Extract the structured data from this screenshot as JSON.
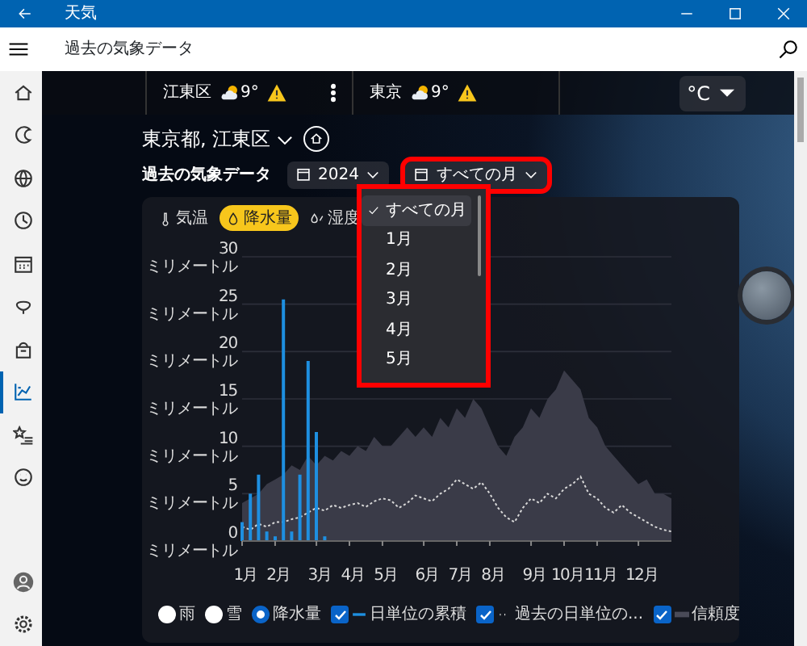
{
  "window": {
    "title": "天気"
  },
  "header": {
    "title": "過去の気象データ"
  },
  "sidebar": {
    "items": [
      {
        "selected": false
      },
      {
        "selected": false
      },
      {
        "selected": false
      },
      {
        "selected": false
      },
      {
        "selected": false
      },
      {
        "selected": false
      },
      {
        "selected": false
      },
      {
        "selected": true
      },
      {
        "selected": false
      },
      {
        "selected": false
      }
    ]
  },
  "locations": [
    {
      "name": "江東区",
      "temp": "9°",
      "alert": true
    },
    {
      "name": "東京",
      "temp": "9°",
      "alert": true
    }
  ],
  "unit": "°C",
  "place": {
    "name": "東京都, 江東区"
  },
  "filters": {
    "title": "過去の気象データ",
    "year": "2024",
    "month": "すべての月",
    "highlighted": true
  },
  "month_menu": {
    "highlighted": true,
    "items": [
      {
        "label": "すべての月",
        "selected": true
      },
      {
        "label": "1月",
        "selected": false
      },
      {
        "label": "2月",
        "selected": false
      },
      {
        "label": "3月",
        "selected": false
      },
      {
        "label": "4月",
        "selected": false
      },
      {
        "label": "5月",
        "selected": false
      }
    ]
  },
  "tabs": [
    {
      "label": "気温",
      "selected": false
    },
    {
      "label": "降水量",
      "selected": true
    },
    {
      "label": "湿度",
      "selected": false
    }
  ],
  "chart": {
    "chart_data": {
      "type": "bar",
      "grid": true,
      "ylim": [
        0,
        30
      ],
      "yticks": [
        {
          "value": 0,
          "label": "0 ミリメートル"
        },
        {
          "value": 5,
          "label": "5 ミリメートル"
        },
        {
          "value": 10,
          "label": "10 ミリメートル"
        },
        {
          "value": 15,
          "label": "15 ミリメートル"
        },
        {
          "value": 20,
          "label": "20 ミリメートル"
        },
        {
          "value": 25,
          "label": "25 ミリメートル"
        },
        {
          "value": 30,
          "label": "30 ミリメートル"
        }
      ],
      "categories": [
        "1月",
        null,
        null,
        null,
        "2月",
        null,
        null,
        null,
        null,
        "3月",
        null,
        null,
        null,
        "4月",
        null,
        null,
        null,
        "5月",
        null,
        null,
        null,
        null,
        "6月",
        null,
        null,
        null,
        "7月",
        null,
        null,
        null,
        "8月",
        null,
        null,
        null,
        null,
        "9月",
        null,
        null,
        null,
        "10月",
        null,
        null,
        null,
        "11月",
        null,
        null,
        null,
        null,
        "12月",
        null,
        null,
        null,
        null
      ],
      "series": [
        {
          "name": "日単位の累積",
          "type": "bar",
          "color": "#1e8fe0",
          "values": [
            2,
            5,
            7,
            1,
            0.5,
            25.5,
            1,
            7,
            19,
            11.5,
            0.5,
            null,
            null,
            null,
            null,
            null,
            null,
            null,
            null,
            null,
            null,
            null,
            null,
            null,
            null,
            null,
            null,
            null,
            null,
            null,
            null,
            null,
            null,
            null,
            null,
            null,
            null,
            null,
            null,
            null,
            null,
            null,
            null,
            null,
            null,
            null,
            null,
            null,
            null,
            null,
            null,
            null,
            null
          ]
        },
        {
          "name": "過去の日単位の...",
          "type": "line",
          "line_style": "dotted",
          "color": "#d8d8d8",
          "values": [
            1.5,
            1.2,
            1.8,
            1.5,
            2,
            2,
            2.3,
            2.5,
            3,
            3.5,
            3.2,
            3.8,
            3.5,
            3.8,
            4,
            3.6,
            4.2,
            4.5,
            4.3,
            3.5,
            4,
            4.8,
            4.5,
            4.2,
            5,
            5.5,
            6.5,
            6,
            5.5,
            6.2,
            5,
            3.5,
            2.5,
            2,
            3.5,
            4.5,
            4,
            5,
            4.5,
            5.5,
            6,
            6.8,
            5,
            4.5,
            3.5,
            3,
            3.8,
            3,
            2.5,
            2,
            1.5,
            1.2,
            1
          ]
        },
        {
          "name": "信頼度",
          "type": "area",
          "color": "#3a3b48",
          "values": [
            4,
            4.5,
            5,
            6,
            6.5,
            7,
            8,
            7.5,
            9,
            8,
            9,
            8.5,
            9.5,
            9,
            10,
            9.5,
            11,
            10,
            10,
            11,
            12,
            11,
            12,
            11,
            13,
            12,
            14,
            13,
            15,
            14,
            12,
            10,
            9,
            11,
            12,
            14,
            13,
            15,
            16,
            18,
            17,
            16,
            13,
            12,
            10,
            9,
            8,
            7,
            6,
            6.5,
            5,
            5,
            4.5
          ]
        }
      ]
    }
  },
  "legend": [
    {
      "kind": "radio",
      "label": "雨",
      "selected": false
    },
    {
      "kind": "radio",
      "label": "雪",
      "selected": false
    },
    {
      "kind": "radio",
      "label": "降水量",
      "selected": true
    },
    {
      "kind": "checkbox",
      "checked": true
    },
    {
      "kind": "checkbox",
      "checked": true
    },
    {
      "kind": "checkbox",
      "checked": true
    }
  ]
}
